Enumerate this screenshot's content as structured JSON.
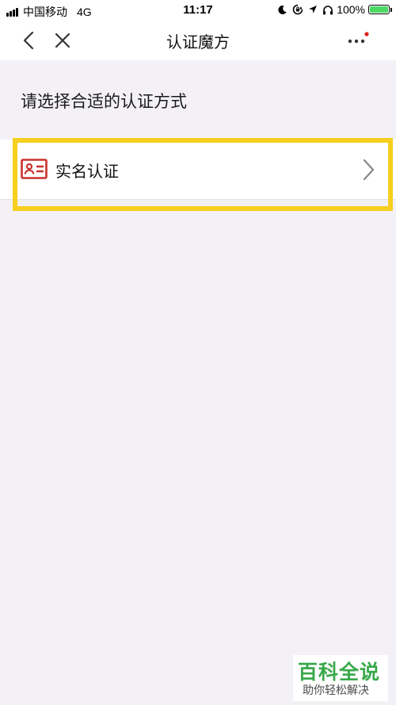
{
  "status_bar": {
    "carrier": "中国移动",
    "network": "4G",
    "time": "11:17",
    "battery": "100%",
    "battery_color": "#4cd964"
  },
  "nav": {
    "title": "认证魔方",
    "back_icon": "chevron-left-icon",
    "close_icon": "close-icon",
    "more_icon": "more-icon",
    "badge_color": "#e02020"
  },
  "main": {
    "prompt": "请选择合适的认证方式",
    "options": [
      {
        "label": "实名认证",
        "icon": "id-card-icon",
        "icon_color": "#c8322e"
      }
    ],
    "highlight_color": "#f6cf1f"
  },
  "watermark": {
    "title": "百科全说",
    "subtitle": "助你轻松解决"
  }
}
